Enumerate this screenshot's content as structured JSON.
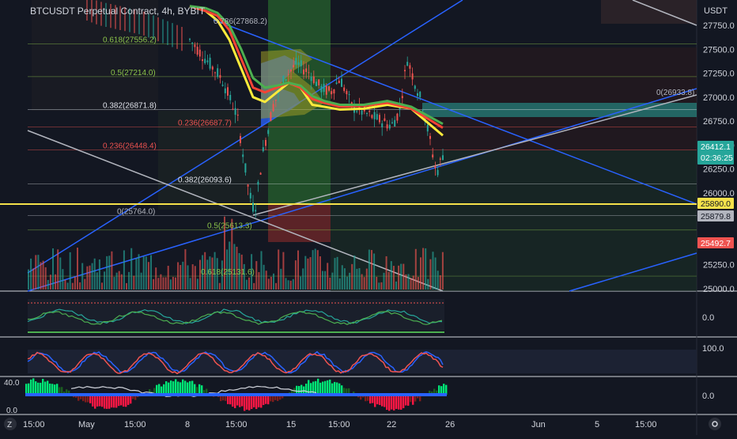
{
  "header": {
    "title": "BTCUSDT Perpetual Contract, 4h, BYBIT"
  },
  "price_axis": {
    "currency": "USDT",
    "ticks": [
      "27750.0",
      "27500.0",
      "27250.0",
      "27000.0",
      "26750.0",
      "26500.0",
      "26250.0",
      "26000.0",
      "25250.0",
      "25000.0"
    ],
    "tick_values": [
      27750,
      27500,
      27250,
      27000,
      26750,
      26500,
      26250,
      26000,
      25250,
      25000
    ],
    "price_range": [
      25000,
      27950
    ]
  },
  "price_badges": [
    {
      "text": "26412.1",
      "sub": "02:36:25",
      "value": 26412.1,
      "color": "#26a69a"
    },
    {
      "text": "25890.0",
      "value": 25890.0,
      "color": "#f5e14a"
    },
    {
      "text": "25879.8",
      "value": 25879.8,
      "color": "#b2b5be"
    },
    {
      "text": "25492.7",
      "value": 25492.7,
      "color": "#ef5350"
    }
  ],
  "fib_labels": [
    {
      "text": "0.618(27556.2)",
      "value": 27556.2,
      "color": "#8bc34a"
    },
    {
      "text": "0.5(27214.0)",
      "value": 27214.0,
      "color": "#8bc34a"
    },
    {
      "text": "0.382(26871.8)",
      "value": 26871.8,
      "color": "#e0e3eb"
    },
    {
      "text": "0.236(26687.7)",
      "value": 26687.7,
      "color": "#ef5350"
    },
    {
      "text": "0.236(26448.4)",
      "value": 26448.4,
      "color": "#ef5350"
    },
    {
      "text": "0.382(26093.6)",
      "value": 26093.6,
      "color": "#e0e3eb"
    },
    {
      "text": "0(25764.0)",
      "value": 25764.0,
      "color": "#b2b5be"
    },
    {
      "text": "0.5(25613.3)",
      "value": 25613.3,
      "color": "#8bc34a"
    },
    {
      "text": "0.618(25131.6)",
      "value": 25131.6,
      "color": "#8bc34a"
    },
    {
      "text": "0.786(27868.2)",
      "value": 27868.2,
      "color": "#b2b5be"
    },
    {
      "text": "0(26933.8)",
      "value": 26933.8,
      "color": "#b2b5be"
    }
  ],
  "panes": {
    "osc1": {
      "tick": "0.0"
    },
    "osc2": {
      "tick": "100.0"
    },
    "osc3": {
      "tick": "0.0",
      "left_ticks": [
        "40.0",
        "0.0"
      ]
    }
  },
  "time_axis": {
    "labels": [
      "15:00",
      "May",
      "15:00",
      "8",
      "15:00",
      "15",
      "15:00",
      "22",
      "26",
      "Jun",
      "5",
      "15:00"
    ]
  },
  "footer": {
    "z_icon": "Z",
    "gear_icon": "gear-icon"
  },
  "chart_data": {
    "type": "candlestick",
    "title": "BTCUSDT Perpetual Contract, 4h, BYBIT",
    "ylabel": "USDT",
    "ylim": [
      25000,
      27950
    ],
    "x_labels": [
      "15:00",
      "May",
      "15:00",
      "8",
      "15:00",
      "15",
      "15:00",
      "22",
      "26",
      "Jun",
      "5",
      "15:00"
    ],
    "series": [
      {
        "name": "ema_yellow",
        "color": "#ffeb3b",
        "values": [
          27950,
          27900,
          27800,
          27600,
          27300,
          27000,
          26950,
          27050,
          27150,
          27100,
          26920,
          26900,
          26870,
          26880,
          26920,
          26880,
          26600
        ]
      },
      {
        "name": "ema_red",
        "color": "#f44336",
        "values": [
          27950,
          27900,
          27850,
          27700,
          27400,
          27100,
          27050,
          27100,
          27150,
          27100,
          26980,
          26940,
          26900,
          26910,
          26940,
          26880,
          26680
        ]
      },
      {
        "name": "ema_green",
        "color": "#4caf50",
        "values": [
          27950,
          27930,
          27880,
          27750,
          27500,
          27200,
          27100,
          27120,
          27150,
          27120,
          27010,
          26960,
          26920,
          26920,
          26960,
          26900,
          26720
        ]
      }
    ],
    "horizontal_levels": [
      27556.2,
      27214.0,
      26871.8,
      26687.7,
      26448.4,
      26093.6,
      25890.0,
      25764.0,
      25613.3,
      25131.6
    ]
  }
}
